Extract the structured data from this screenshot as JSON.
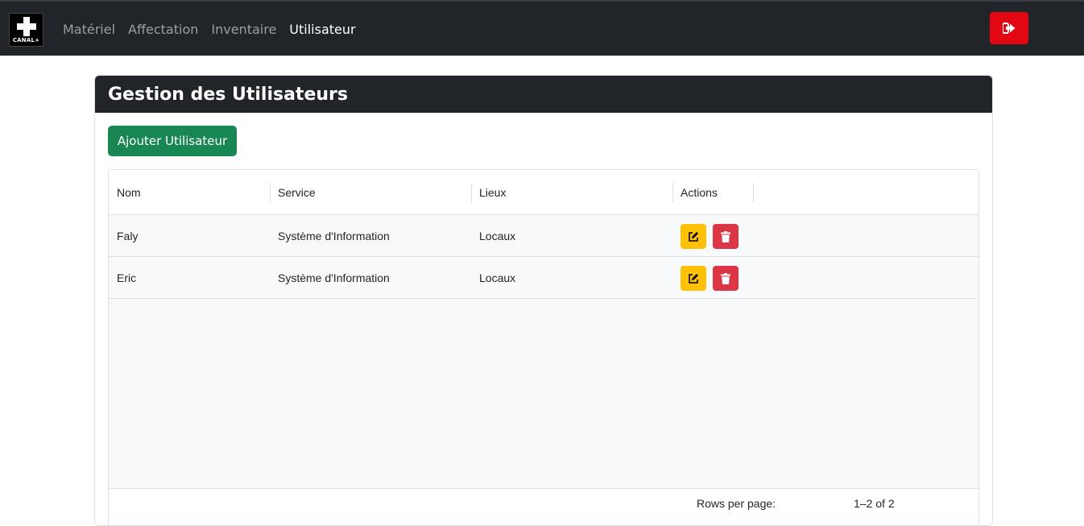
{
  "navbar": {
    "logo_text": "CANAL+",
    "links": [
      {
        "label": "Matériel"
      },
      {
        "label": "Affectation"
      },
      {
        "label": "Inventaire"
      },
      {
        "label": "Utilisateur"
      }
    ],
    "active_link": "Utilisateur",
    "logout_icon": "sign-out-icon",
    "logout_color": "#e30613"
  },
  "page": {
    "title": "Gestion des Utilisateurs",
    "add_button_label": "Ajouter Utilisateur"
  },
  "table": {
    "columns": [
      "Nom",
      "Service",
      "Lieux",
      "Actions"
    ],
    "rows": [
      {
        "nom": "Faly",
        "service": "Système d'Information",
        "lieux": "Locaux"
      },
      {
        "nom": "Eric",
        "service": "Système d'Information",
        "lieux": "Locaux"
      }
    ],
    "footer": {
      "rows_per_page_label": "Rows per page:",
      "range": "1–2 of 2"
    }
  },
  "colors": {
    "navbar": "#212529",
    "add_button": "#198754",
    "edit_button": "#ffc107",
    "delete_button": "#dc3545"
  }
}
